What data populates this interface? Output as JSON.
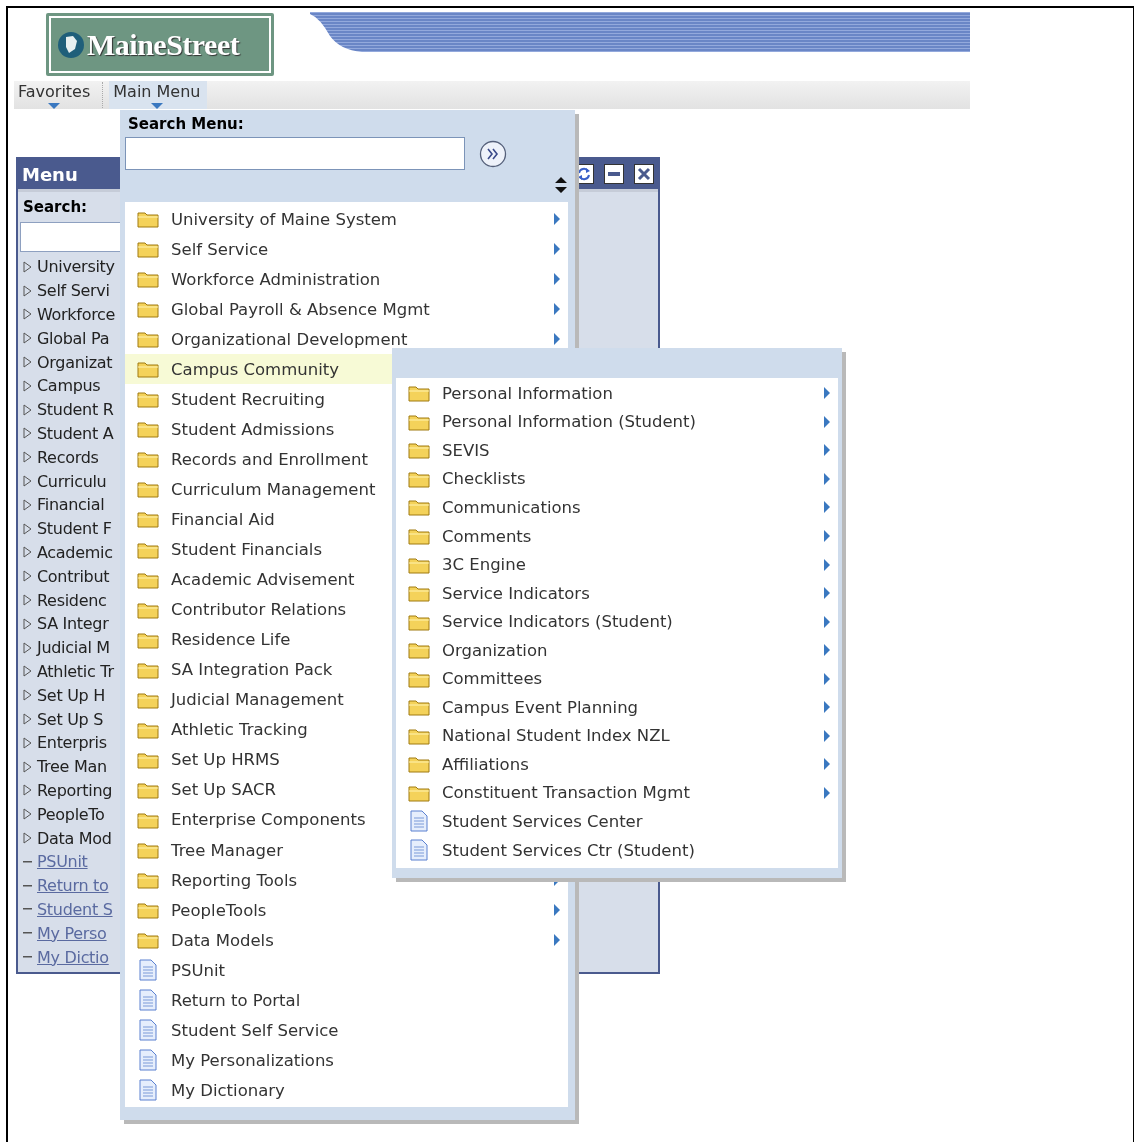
{
  "logo": {
    "text": "MaineStreet"
  },
  "nav": [
    {
      "label": "Favorites",
      "selected": false
    },
    {
      "label": "Main Menu",
      "selected": true
    }
  ],
  "panel": {
    "title": "Menu",
    "search_label": "Search:",
    "items": [
      {
        "label": "University",
        "kind": "folder"
      },
      {
        "label": "Self Servi",
        "kind": "folder"
      },
      {
        "label": "Workforce",
        "kind": "folder"
      },
      {
        "label": "Global Pa",
        "kind": "folder"
      },
      {
        "label": "Organizat",
        "kind": "folder"
      },
      {
        "label": "Campus",
        "kind": "folder"
      },
      {
        "label": "Student R",
        "kind": "folder"
      },
      {
        "label": "Student A",
        "kind": "folder"
      },
      {
        "label": "Records",
        "kind": "folder"
      },
      {
        "label": "Curriculu",
        "kind": "folder"
      },
      {
        "label": "Financial",
        "kind": "folder"
      },
      {
        "label": "Student F",
        "kind": "folder"
      },
      {
        "label": "Academic",
        "kind": "folder"
      },
      {
        "label": "Contribut",
        "kind": "folder"
      },
      {
        "label": "Residenc",
        "kind": "folder"
      },
      {
        "label": "SA Integr",
        "kind": "folder"
      },
      {
        "label": "Judicial M",
        "kind": "folder"
      },
      {
        "label": "Athletic Tr",
        "kind": "folder"
      },
      {
        "label": "Set Up H",
        "kind": "folder"
      },
      {
        "label": "Set Up S",
        "kind": "folder"
      },
      {
        "label": "Enterpris",
        "kind": "folder"
      },
      {
        "label": "Tree Man",
        "kind": "folder"
      },
      {
        "label": "Reporting",
        "kind": "folder"
      },
      {
        "label": "PeopleTo",
        "kind": "folder"
      },
      {
        "label": "Data Mod",
        "kind": "folder"
      },
      {
        "label": "PSUnit",
        "kind": "link"
      },
      {
        "label": "Return to",
        "kind": "link"
      },
      {
        "label": "Student S",
        "kind": "link"
      },
      {
        "label": "My Perso",
        "kind": "link"
      },
      {
        "label": "My Dictio",
        "kind": "link"
      }
    ]
  },
  "dropdown": {
    "search_label": "Search Menu:",
    "items": [
      {
        "label": "University of Maine System",
        "kind": "folder",
        "arrow": true,
        "selected": false
      },
      {
        "label": "Self Service",
        "kind": "folder",
        "arrow": true,
        "selected": false
      },
      {
        "label": "Workforce Administration",
        "kind": "folder",
        "arrow": true,
        "selected": false
      },
      {
        "label": "Global Payroll & Absence Mgmt",
        "kind": "folder",
        "arrow": true,
        "selected": false
      },
      {
        "label": "Organizational Development",
        "kind": "folder",
        "arrow": true,
        "selected": false
      },
      {
        "label": "Campus Community",
        "kind": "folder",
        "arrow": false,
        "selected": true
      },
      {
        "label": "Student Recruiting",
        "kind": "folder",
        "arrow": false,
        "selected": false
      },
      {
        "label": "Student Admissions",
        "kind": "folder",
        "arrow": false,
        "selected": false
      },
      {
        "label": "Records and Enrollment",
        "kind": "folder",
        "arrow": false,
        "selected": false
      },
      {
        "label": "Curriculum Management",
        "kind": "folder",
        "arrow": false,
        "selected": false
      },
      {
        "label": "Financial Aid",
        "kind": "folder",
        "arrow": false,
        "selected": false
      },
      {
        "label": "Student Financials",
        "kind": "folder",
        "arrow": false,
        "selected": false
      },
      {
        "label": "Academic Advisement",
        "kind": "folder",
        "arrow": false,
        "selected": false
      },
      {
        "label": "Contributor Relations",
        "kind": "folder",
        "arrow": false,
        "selected": false
      },
      {
        "label": "Residence Life",
        "kind": "folder",
        "arrow": false,
        "selected": false
      },
      {
        "label": "SA Integration Pack",
        "kind": "folder",
        "arrow": false,
        "selected": false
      },
      {
        "label": "Judicial Management",
        "kind": "folder",
        "arrow": false,
        "selected": false
      },
      {
        "label": "Athletic Tracking",
        "kind": "folder",
        "arrow": false,
        "selected": false
      },
      {
        "label": "Set Up HRMS",
        "kind": "folder",
        "arrow": false,
        "selected": false
      },
      {
        "label": "Set Up SACR",
        "kind": "folder",
        "arrow": false,
        "selected": false
      },
      {
        "label": "Enterprise Components",
        "kind": "folder",
        "arrow": false,
        "selected": false
      },
      {
        "label": "Tree Manager",
        "kind": "folder",
        "arrow": false,
        "selected": false
      },
      {
        "label": "Reporting Tools",
        "kind": "folder",
        "arrow": true,
        "selected": false
      },
      {
        "label": "PeopleTools",
        "kind": "folder",
        "arrow": true,
        "selected": false
      },
      {
        "label": "Data Models",
        "kind": "folder",
        "arrow": true,
        "selected": false
      },
      {
        "label": "PSUnit",
        "kind": "page",
        "arrow": false,
        "selected": false
      },
      {
        "label": "Return to Portal",
        "kind": "page",
        "arrow": false,
        "selected": false
      },
      {
        "label": "Student Self Service",
        "kind": "page",
        "arrow": false,
        "selected": false
      },
      {
        "label": "My Personalizations",
        "kind": "page",
        "arrow": false,
        "selected": false
      },
      {
        "label": "My Dictionary",
        "kind": "page",
        "arrow": false,
        "selected": false
      }
    ]
  },
  "submenu": {
    "items": [
      {
        "label": "Personal Information",
        "kind": "folder"
      },
      {
        "label": "Personal Information (Student)",
        "kind": "folder"
      },
      {
        "label": "SEVIS",
        "kind": "folder"
      },
      {
        "label": "Checklists",
        "kind": "folder"
      },
      {
        "label": "Communications",
        "kind": "folder"
      },
      {
        "label": "Comments",
        "kind": "folder"
      },
      {
        "label": "3C Engine",
        "kind": "folder"
      },
      {
        "label": "Service Indicators",
        "kind": "folder"
      },
      {
        "label": "Service Indicators (Student)",
        "kind": "folder"
      },
      {
        "label": "Organization",
        "kind": "folder"
      },
      {
        "label": "Committees",
        "kind": "folder"
      },
      {
        "label": "Campus Event Planning",
        "kind": "folder"
      },
      {
        "label": "National Student Index NZL",
        "kind": "folder"
      },
      {
        "label": "Affiliations",
        "kind": "folder"
      },
      {
        "label": "Constituent Transaction Mgmt",
        "kind": "folder"
      },
      {
        "label": "Student Services Center",
        "kind": "page"
      },
      {
        "label": "Student Services Ctr (Student)",
        "kind": "page"
      }
    ]
  }
}
